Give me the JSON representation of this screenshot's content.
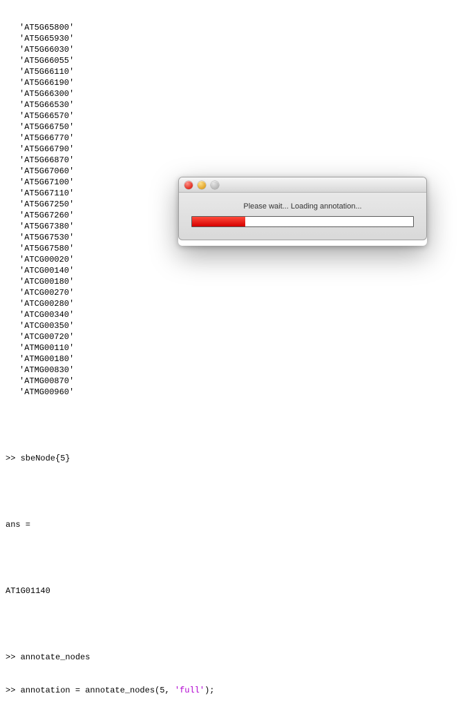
{
  "console": {
    "gene_list": [
      "'AT5G65800'",
      "'AT5G65930'",
      "'AT5G66030'",
      "'AT5G66055'",
      "'AT5G66110'",
      "'AT5G66190'",
      "'AT5G66300'",
      "'AT5G66530'",
      "'AT5G66570'",
      "'AT5G66750'",
      "'AT5G66770'",
      "'AT5G66790'",
      "'AT5G66870'",
      "'AT5G67060'",
      "'AT5G67100'",
      "'AT5G67110'",
      "'AT5G67250'",
      "'AT5G67260'",
      "'AT5G67380'",
      "'AT5G67530'",
      "'AT5G67580'",
      "'ATCG00020'",
      "'ATCG00140'",
      "'ATCG00180'",
      "'ATCG00270'",
      "'ATCG00280'",
      "'ATCG00340'",
      "'ATCG00350'",
      "'ATCG00720'",
      "'ATMG00110'",
      "'ATMG00180'",
      "'ATMG00830'",
      "'ATMG00870'",
      "'ATMG00960'"
    ],
    "cmd1": ">> sbeNode{5}",
    "ans_label": "ans =",
    "ans_value": "AT1G01140",
    "cmd2": ">> annotate_nodes",
    "cmd3_prefix": ">> annotation = annotate_nodes(5, ",
    "cmd3_string": "'full'",
    "cmd3_suffix": ");"
  },
  "dialog": {
    "message": "Please wait... Loading annotation...",
    "progress_percent": 24
  }
}
